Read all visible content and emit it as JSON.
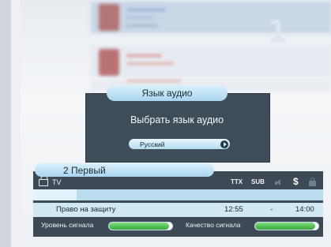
{
  "audio_dialog": {
    "title": "Язык аудио",
    "heading": "Выбрать язык аудио",
    "selected_language": "Русский"
  },
  "info_bar": {
    "channel": "2 Первый",
    "source": "TV",
    "indicators": {
      "ttx": "TTX",
      "sub": "SUB"
    },
    "icons": [
      "tv-icon",
      "speaker-icon",
      "dollar-icon",
      "lock-icon"
    ],
    "program": {
      "title": "Право на защиту",
      "start": "12:55",
      "separator": "-",
      "end": "14:00",
      "progress_fraction": 0.15
    },
    "signal_level_label": "Уровень сигнала",
    "signal_quality_label": "Качество сигнала",
    "signal_level": 0.95,
    "signal_quality": 0.95
  },
  "colors": {
    "panel": "#3d4a55",
    "tab": "#a9d6ee",
    "meter_fill": "#3aa53b"
  }
}
